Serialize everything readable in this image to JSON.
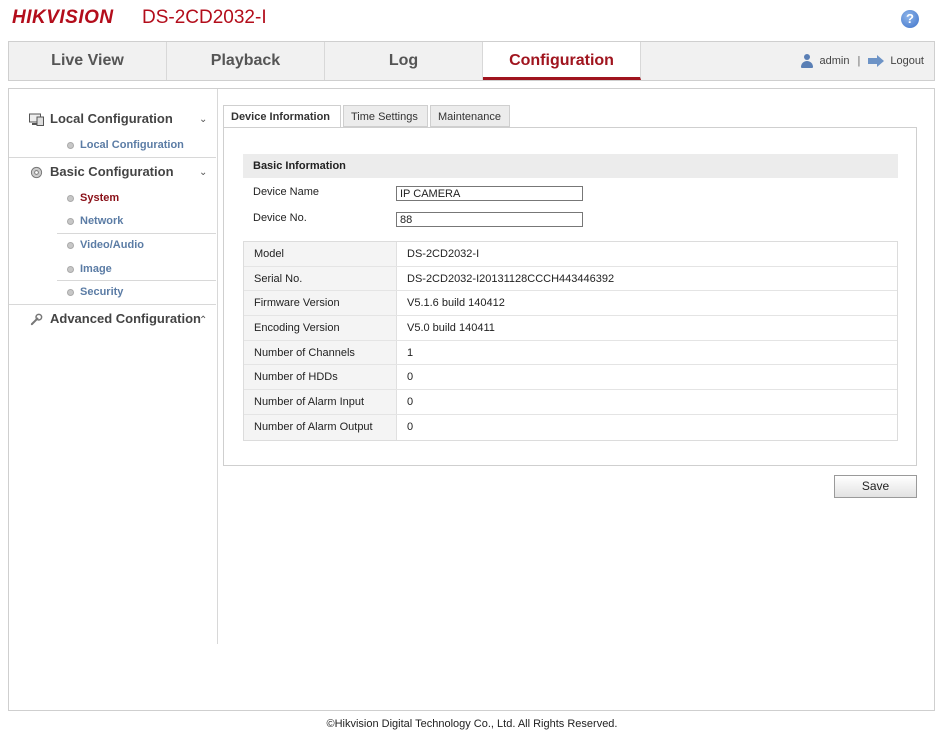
{
  "header": {
    "logo": "HIKVISION",
    "model": "DS-2CD2032-I",
    "help_icon": "help-icon"
  },
  "nav": {
    "tabs": [
      {
        "label": "Live View"
      },
      {
        "label": "Playback"
      },
      {
        "label": "Log"
      },
      {
        "label": "Configuration",
        "active": true
      }
    ],
    "user": "admin",
    "separator": "|",
    "logout": "Logout"
  },
  "sidebar": {
    "sections": [
      {
        "title": "Local Configuration",
        "icon": "monitor-icon",
        "expanded": true,
        "items": [
          "Local Configuration"
        ]
      },
      {
        "title": "Basic Configuration",
        "icon": "gear-icon",
        "expanded": true,
        "items": [
          "System",
          "Network",
          "Video/Audio",
          "Image",
          "Security"
        ],
        "active_item": "System"
      },
      {
        "title": "Advanced Configuration",
        "icon": "wrench-icon",
        "expanded": false,
        "items": []
      }
    ]
  },
  "tabs": [
    {
      "label": "Device Information",
      "active": true
    },
    {
      "label": "Time Settings"
    },
    {
      "label": "Maintenance"
    }
  ],
  "basic": {
    "heading": "Basic Information",
    "device_name_label": "Device Name",
    "device_name_value": "IP CAMERA",
    "device_no_label": "Device No.",
    "device_no_value": "88"
  },
  "info_rows": [
    {
      "label": "Model",
      "value": "DS-2CD2032-I"
    },
    {
      "label": "Serial No.",
      "value": "DS-2CD2032-I20131128CCCH443446392"
    },
    {
      "label": "Firmware Version",
      "value": "V5.1.6 build 140412"
    },
    {
      "label": "Encoding Version",
      "value": "V5.0 build 140411"
    },
    {
      "label": "Number of Channels",
      "value": "1"
    },
    {
      "label": "Number of HDDs",
      "value": "0"
    },
    {
      "label": "Number of Alarm Input",
      "value": "0"
    },
    {
      "label": "Number of Alarm Output",
      "value": "0"
    }
  ],
  "save_label": "Save",
  "footer": "©Hikvision Digital Technology Co., Ltd. All Rights Reserved."
}
